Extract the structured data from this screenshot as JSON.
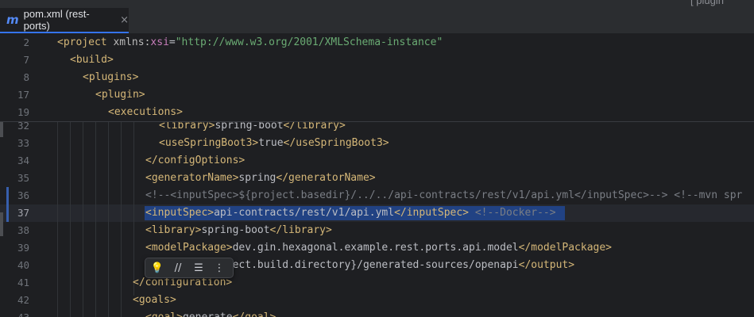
{
  "tab": {
    "icon_glyph": "m",
    "label": "pom.xml (rest-ports)",
    "close_glyph": "×"
  },
  "corner_partial_text": "[ plugin",
  "sticky_lines": [
    {
      "number": "2",
      "tokens": [
        {
          "t": "<",
          "c": "tag"
        },
        {
          "t": "project",
          "c": "tag"
        },
        {
          "t": " xmlns",
          "c": "attr"
        },
        {
          "t": ":",
          "c": "attr"
        },
        {
          "t": "xsi",
          "c": "ns"
        },
        {
          "t": "=",
          "c": "txt"
        },
        {
          "t": "\"http://www.w3.org/2001/XMLSchema-instance\"",
          "c": "str"
        }
      ]
    },
    {
      "number": "7",
      "tokens": [
        {
          "t": "<build>",
          "c": "tag"
        }
      ]
    },
    {
      "number": "8",
      "tokens": [
        {
          "t": "<plugins>",
          "c": "tag"
        }
      ]
    },
    {
      "number": "17",
      "tokens": [
        {
          "t": "<plugin>",
          "c": "tag"
        }
      ]
    },
    {
      "number": "19",
      "tokens": [
        {
          "t": "<executions>",
          "c": "tag"
        }
      ]
    }
  ],
  "lines": [
    {
      "number": "32",
      "tokens": [
        {
          "t": "<library>",
          "c": "tag"
        },
        {
          "t": "spring-boot",
          "c": "txt"
        },
        {
          "t": "</library>",
          "c": "tag"
        }
      ]
    },
    {
      "number": "33",
      "tokens": [
        {
          "t": "<useSpringBoot3>",
          "c": "tag"
        },
        {
          "t": "true",
          "c": "txt"
        },
        {
          "t": "</useSpringBoot3>",
          "c": "tag"
        }
      ]
    },
    {
      "number": "34",
      "tokens": [
        {
          "t": "</configOptions>",
          "c": "tag"
        }
      ]
    },
    {
      "number": "35",
      "tokens": [
        {
          "t": "<generatorName>",
          "c": "tag"
        },
        {
          "t": "spring",
          "c": "txt"
        },
        {
          "t": "</generatorName>",
          "c": "tag"
        }
      ]
    },
    {
      "number": "36",
      "tokens": [
        {
          "t": "<!--<inputSpec>${project.basedir}/../../api-contracts/rest/v1/api.yml</inputSpec>--> <!--mvn spr",
          "c": "cmt"
        }
      ]
    },
    {
      "number": "37",
      "tokens": [
        {
          "t": "<inputSpec>",
          "c": "tag"
        },
        {
          "t": "api-contracts/rest/v1/api.yml",
          "c": "txt"
        },
        {
          "t": "</inputSpec>",
          "c": "tag"
        },
        {
          "t": " ",
          "c": "txt"
        },
        {
          "t": "<!--Docker-->",
          "c": "cmt"
        }
      ]
    },
    {
      "number": "38",
      "tokens": [
        {
          "t": "<library>",
          "c": "tag"
        },
        {
          "t": "spring-boot",
          "c": "txt"
        },
        {
          "t": "</library>",
          "c": "tag"
        }
      ]
    },
    {
      "number": "39",
      "tokens": [
        {
          "t": "<modelPackage>",
          "c": "tag"
        },
        {
          "t": "dev.gin.hexagonal.example.rest.ports.api.model",
          "c": "txt"
        },
        {
          "t": "</modelPackage>",
          "c": "tag"
        }
      ]
    },
    {
      "number": "40",
      "tokens": [
        {
          "t": "<output>",
          "c": "tag"
        },
        {
          "t": "${project.build.directory}/generated-sources/openapi",
          "c": "txt"
        },
        {
          "t": "</output>",
          "c": "tag"
        }
      ]
    },
    {
      "number": "41",
      "tokens": [
        {
          "t": "</configuration>",
          "c": "tag"
        }
      ]
    },
    {
      "number": "42",
      "tokens": [
        {
          "t": "<goals>",
          "c": "tag"
        }
      ]
    },
    {
      "number": "43",
      "tokens": [
        {
          "t": "<goal>",
          "c": "tag"
        },
        {
          "t": "generate",
          "c": "txt"
        },
        {
          "t": "</goal>",
          "c": "tag"
        }
      ]
    }
  ],
  "floating_toolbar": {
    "buttons": [
      {
        "name": "intention-bulb-icon",
        "glyph": "💡"
      },
      {
        "name": "comment-icon",
        "glyph": "//"
      },
      {
        "name": "reformat-icon",
        "glyph": "☰"
      },
      {
        "name": "more-icon",
        "glyph": "⋮"
      }
    ]
  },
  "colors": {
    "background": "#1e1f22",
    "tag": "#d5b778",
    "string": "#6aab73",
    "comment": "#7a7e85",
    "selection": "#214283",
    "accent": "#3574f0"
  }
}
